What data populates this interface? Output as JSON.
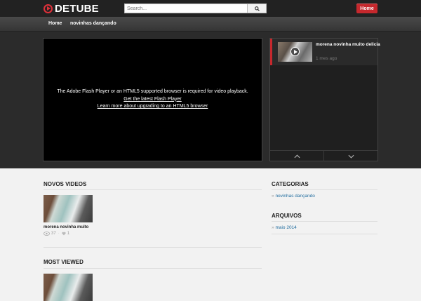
{
  "app": {
    "logo_text": "DETUBE"
  },
  "search": {
    "placeholder": "Search..."
  },
  "top": {
    "home_label": "Home"
  },
  "nav": {
    "items": [
      {
        "label": "Home"
      },
      {
        "label": "novinhas dançando"
      }
    ]
  },
  "player": {
    "message": "The Adobe Flash Player or an HTML5 supported browser is required for video playback.",
    "link1": "Get the latest Flash Player",
    "link2": "Learn more about upgrading to an HTML5 browser"
  },
  "sidebar": {
    "items": [
      {
        "title": "morena novinha muito delicia",
        "date": "1 mes ago"
      }
    ]
  },
  "sections": {
    "novos": {
      "title": "NOVOS VIDEOS",
      "items": [
        {
          "title": "morena novinha muito",
          "views": "37",
          "likes": "1"
        }
      ]
    },
    "most_viewed": {
      "title": "MOST VIEWED"
    }
  },
  "widgets": {
    "categorias": {
      "title": "CATEGORIAS",
      "items": [
        {
          "label": "novinhas dançando"
        }
      ]
    },
    "arquivos": {
      "title": "ARQUIVOS",
      "items": [
        {
          "label": "maio 2014"
        }
      ]
    }
  },
  "colors": {
    "accent": "#c6282d",
    "link": "#1e6b9e",
    "dark_bg": "#2b2b2b"
  }
}
